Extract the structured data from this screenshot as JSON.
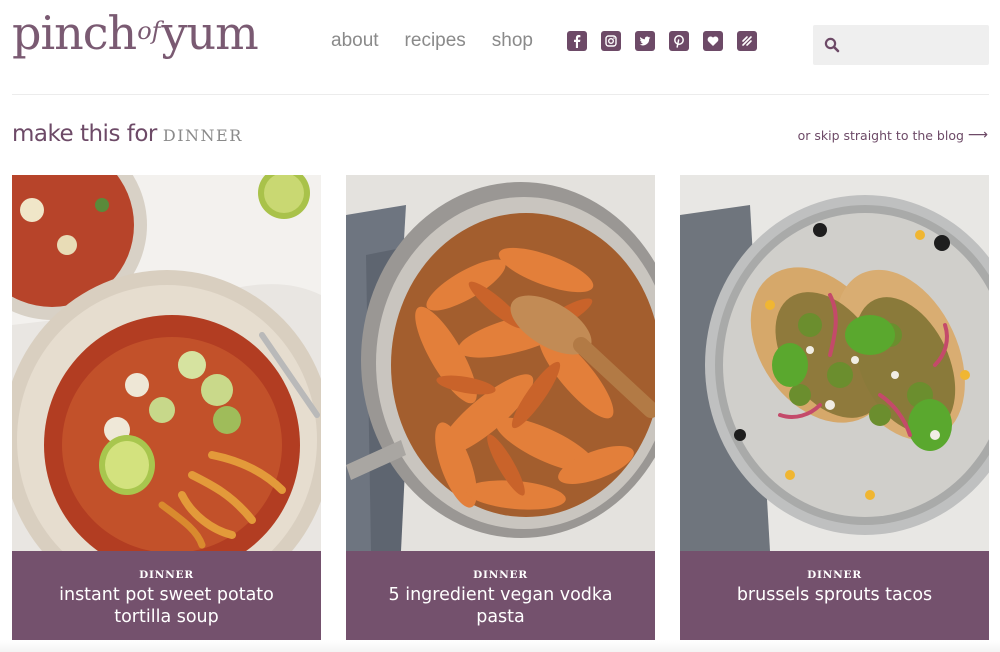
{
  "brand": {
    "logo_left": "pinch",
    "logo_of": "of",
    "logo_right": "yum",
    "accent_color": "#6d4a67",
    "caption_color": "#74516d"
  },
  "nav": {
    "items": [
      {
        "label": "about"
      },
      {
        "label": "recipes"
      },
      {
        "label": "shop"
      }
    ]
  },
  "social": {
    "icons": [
      "facebook-icon",
      "instagram-icon",
      "twitter-icon",
      "pinterest-icon",
      "bloglovin-icon",
      "feed-icon"
    ]
  },
  "search": {
    "placeholder": ""
  },
  "section": {
    "title_main": "make this for",
    "title_accent": "DINNER",
    "skip_label": "or skip straight to the blog",
    "skip_arrow": "⟶"
  },
  "cards": [
    {
      "category": "DINNER",
      "title": "instant pot sweet potato tortilla soup"
    },
    {
      "category": "DINNER",
      "title": "5 ingredient vegan vodka pasta"
    },
    {
      "category": "DINNER",
      "title": "brussels sprouts tacos"
    }
  ]
}
